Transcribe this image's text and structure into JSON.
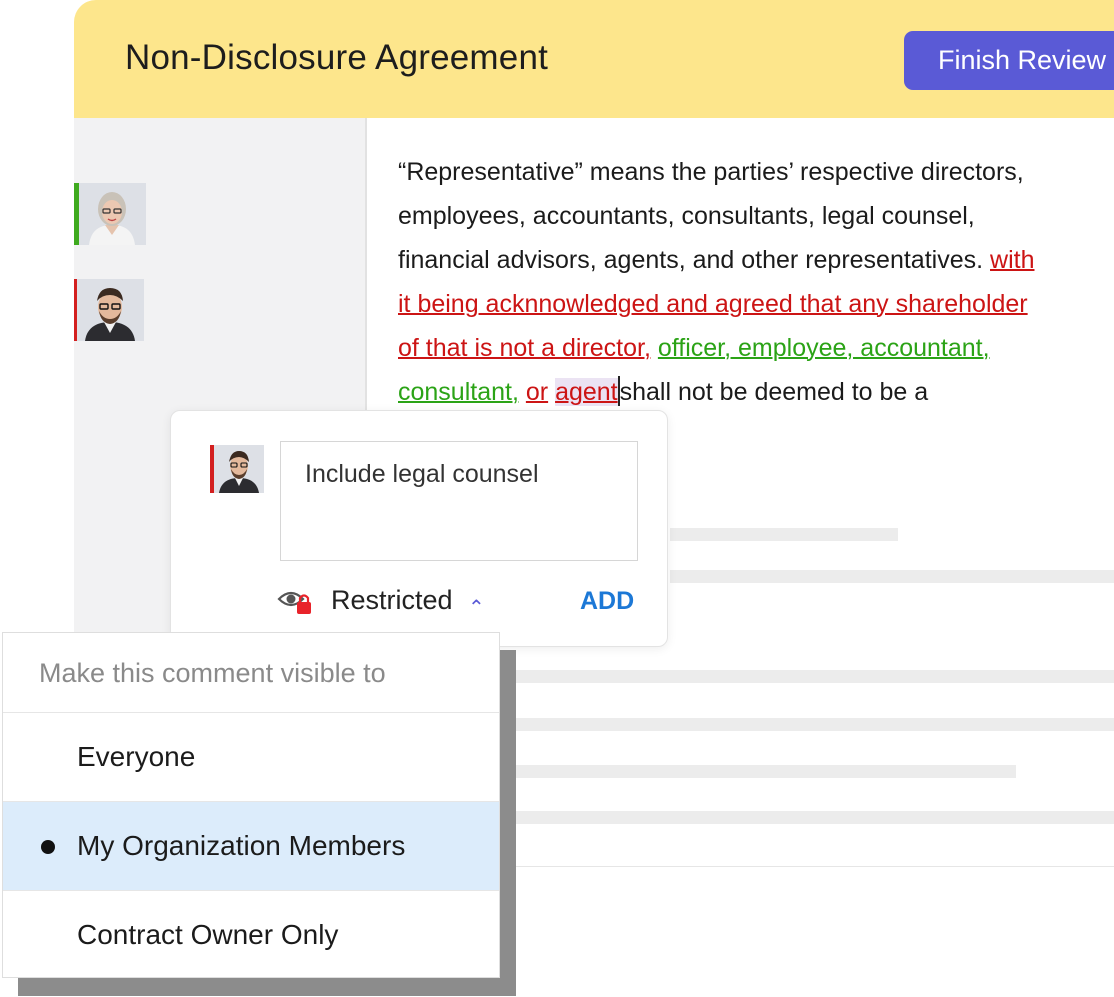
{
  "header": {
    "title": "Non-Disclosure Agreement",
    "finish_label": "Finish Review"
  },
  "reviewers": [
    {
      "name": "reviewer-1",
      "status_color": "#3faa1f"
    },
    {
      "name": "reviewer-2",
      "status_color": "#d31f1f"
    }
  ],
  "document": {
    "line1": "“Representative” means the parties’ respective directors,",
    "line2": "employees, accountants, consultants, legal counsel,",
    "line3_plain": "financial advisors, agents, and other representatives.",
    "line3_deleted": "with",
    "line4_deleted": "it being acknnowledged and agreed that any shareholder",
    "line5_deleted": "of that is not a director,",
    "line5_inserted": "officer, employee, accountant,",
    "line6_inserted": "consultant,",
    "line6_deleted": "or",
    "line6_highlight": "agent",
    "line6_plain": "shall not be deemed to be a"
  },
  "comment": {
    "text": "Include legal counsel",
    "visibility_label": "Restricted",
    "add_label": "ADD"
  },
  "visibility_menu": {
    "header": "Make this comment visible to",
    "options": [
      "Everyone",
      "My Organization Members",
      "Contract Owner Only"
    ],
    "selected": "My Organization Members"
  },
  "colors": {
    "header_bg": "#fde68c",
    "primary_button": "#5a5ad6",
    "deleted_text": "#cc1414",
    "inserted_text": "#2ba316",
    "link_blue": "#1c78d6",
    "selected_row": "#dcecfb"
  }
}
